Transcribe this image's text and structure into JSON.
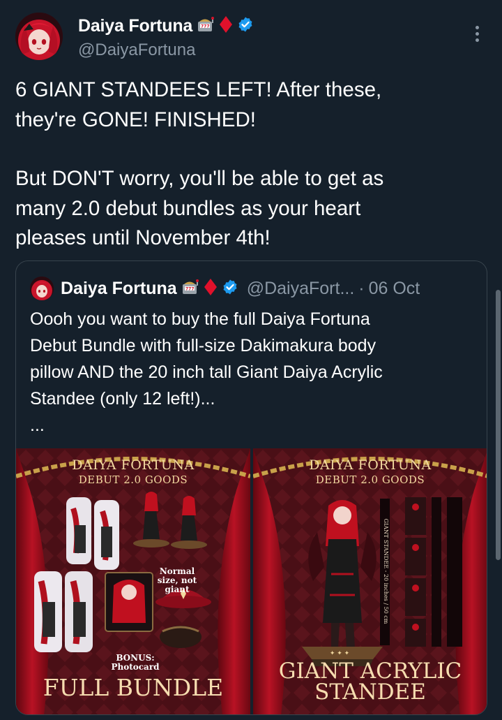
{
  "post": {
    "author": {
      "display_name": "Daiya Fortuna",
      "handle": "@DaiyaFortuna",
      "badge_icons": [
        "slot-machine-icon",
        "red-diamond-icon",
        "verified-badge-icon"
      ]
    },
    "paragraphs": [
      "6 GIANT STANDEES LEFT! After these,\nthey're GONE! FINISHED!",
      "But DON'T worry, you'll be able to get as\nmany 2.0 debut bundles as your heart\npleases until November 4th!"
    ]
  },
  "quote": {
    "author": {
      "display_name": "Daiya Fortuna",
      "handle": "@DaiyaFort...",
      "date_sep": "·",
      "date": "06 Oct"
    },
    "text": "Oooh you want to buy the full Daiya Fortuna\nDebut Bundle with full-size Dakimakura body\npillow AND the 20 inch tall Giant Daiya Acrylic\nStandee (only 12 left!)...\n...",
    "media": [
      {
        "title_line1": "DAIYA FORTUNA",
        "title_line2": "DEBUT 2.0 GOODS",
        "note_normal": "Normal size,\nnot giant",
        "note_bonus": "BONUS:\nPhotocard",
        "caption": "FULL BUNDLE"
      },
      {
        "title_line1": "DAIYA FORTUNA",
        "title_line2": "DEBUT 2.0 GOODS",
        "vertical_text": "GIANT STANDEE - 20 inches / 50 cm",
        "caption_line1": "GIANT ACRYLIC",
        "caption_line2": "STANDEE"
      }
    ]
  },
  "colors": {
    "background": "#15202b",
    "text": "#ffffff",
    "secondary": "#8b98a5",
    "border": "#38444d",
    "verified": "#1d9bf0",
    "diamond": "#e0112b"
  }
}
